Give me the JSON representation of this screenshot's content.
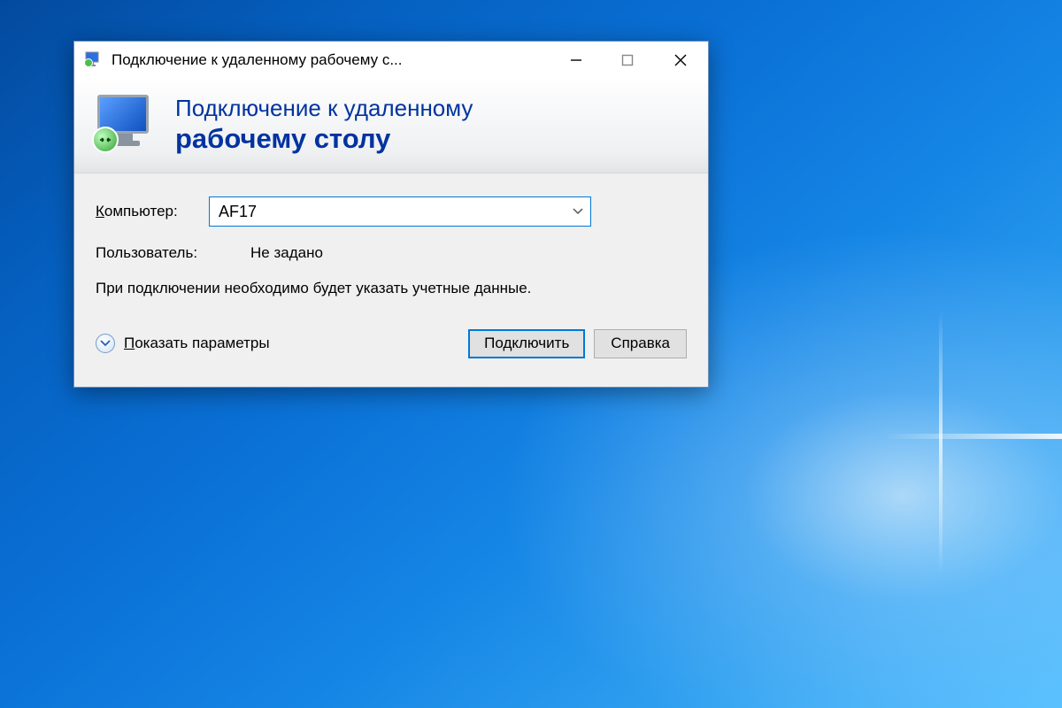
{
  "window": {
    "title": "Подключение к удаленному рабочему с..."
  },
  "banner": {
    "line1": "Подключение к удаленному",
    "line2": "рабочему столу"
  },
  "form": {
    "computer_label": "Компьютер:",
    "computer_value": "AF17",
    "user_label": "Пользователь:",
    "user_value": "Не задано",
    "info_text": "При подключении необходимо будет указать учетные данные."
  },
  "footer": {
    "show_options": "Показать параметры",
    "connect": "Подключить",
    "help": "Справка"
  }
}
